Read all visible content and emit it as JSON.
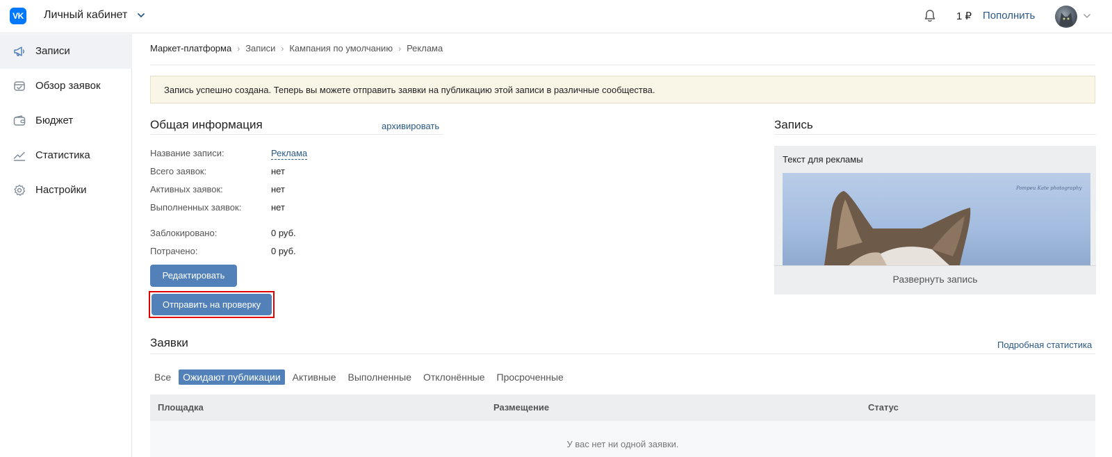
{
  "header": {
    "logo_text": "VK",
    "cabinet_label": "Личный кабинет",
    "balance": "1 ₽",
    "topup_label": "Пополнить"
  },
  "sidebar": {
    "items": [
      {
        "label": "Записи",
        "icon": "megaphone-icon",
        "active": true
      },
      {
        "label": "Обзор заявок",
        "icon": "requests-icon",
        "active": false
      },
      {
        "label": "Бюджет",
        "icon": "wallet-icon",
        "active": false
      },
      {
        "label": "Статистика",
        "icon": "chart-icon",
        "active": false
      },
      {
        "label": "Настройки",
        "icon": "gear-icon",
        "active": false
      }
    ]
  },
  "breadcrumb": [
    "Маркет-платформа",
    "Записи",
    "Кампания по умолчанию",
    "Реклама"
  ],
  "notice": "Запись успешно создана. Теперь вы можете отправить заявки на публикацию этой записи в различные сообщества.",
  "general": {
    "title": "Общая информация",
    "archive_label": "архивировать",
    "rows": [
      {
        "label": "Название записи:",
        "value": "Реклама"
      },
      {
        "label": "Всего заявок:",
        "value": "нет"
      },
      {
        "label": "Активных заявок:",
        "value": "нет"
      },
      {
        "label": "Выполненных заявок:",
        "value": "нет"
      },
      {
        "label": "Заблокировано:",
        "value": "0 руб."
      },
      {
        "label": "Потрачено:",
        "value": "0 руб."
      }
    ],
    "edit_label": "Редактировать",
    "send_label": "Отправить на проверку"
  },
  "post": {
    "title": "Запись",
    "text": "Текст для рекламы",
    "image_caption": "Pompeu Kate photography",
    "expand_label": "Развернуть запись"
  },
  "requests": {
    "title": "Заявки",
    "stats_label": "Подробная статистика",
    "tabs": [
      "Все",
      "Ожидают публикации",
      "Активные",
      "Выполненные",
      "Отклонённые",
      "Просроченные"
    ],
    "active_tab": 1,
    "columns": [
      "Площадка",
      "Размещение",
      "Статус"
    ],
    "empty_text": "У вас нет ни одной заявки."
  },
  "colors": {
    "accent": "#5181b8",
    "link": "#2a5885",
    "logo": "#0077ff",
    "highlight_frame": "#e00000"
  }
}
